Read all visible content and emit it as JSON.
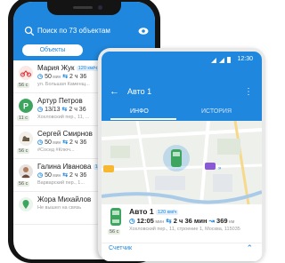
{
  "list_screen": {
    "search_placeholder": "Поиск по 73 объектам",
    "tab_objects": "Объекты",
    "rows": [
      {
        "name": "Мария Жук",
        "badge": "120 км/ч",
        "speed": "50",
        "speed_unit": "мин",
        "time": "2 ч 36",
        "suffix": "мин",
        "address": "ул. Большая Каменщ...",
        "age": "56 с"
      },
      {
        "name": "Артур Петров",
        "badge": "",
        "speed": "13/13",
        "speed_unit": "",
        "time": "2 ч 36",
        "suffix": "мин",
        "address": "Хохловский пер., 11, ...",
        "age": "11 с"
      },
      {
        "name": "Сергей Смирнов",
        "badge": "",
        "speed": "50",
        "speed_unit": "мин",
        "time": "2 ч 36",
        "suffix": "",
        "address": "#Сосед  #Ключ...",
        "age": "56 с"
      },
      {
        "name": "Галина Иванова",
        "badge": "120",
        "speed": "50",
        "speed_unit": "мин",
        "time": "2 ч 36",
        "suffix": "",
        "address": "Варварский пер., 1...",
        "age": "56 с"
      },
      {
        "name": "Жора Михайлов",
        "badge": "",
        "speed": "",
        "speed_unit": "",
        "time": "",
        "suffix": "",
        "address": "Не вышел на связь",
        "age": ""
      }
    ]
  },
  "detail_screen": {
    "status_time": "12:30",
    "title": "Авто 1",
    "tab_info": "ИНФО",
    "tab_history": "ИСТОРИЯ",
    "card": {
      "name": "Авто 1",
      "badge": "120 км/ч",
      "duration_value": "12:05",
      "duration_unit": "мин",
      "time": "2 ч 36 мин",
      "distance": "369",
      "distance_unit": "км",
      "address": "Хохловский пер., 11, строение 1, Москва, 115035",
      "age": "56 с"
    },
    "counter_label": "Счетчик"
  },
  "colors": {
    "accent": "#1f87dd",
    "green": "#3ea55f",
    "phone_dark": "#141414"
  }
}
